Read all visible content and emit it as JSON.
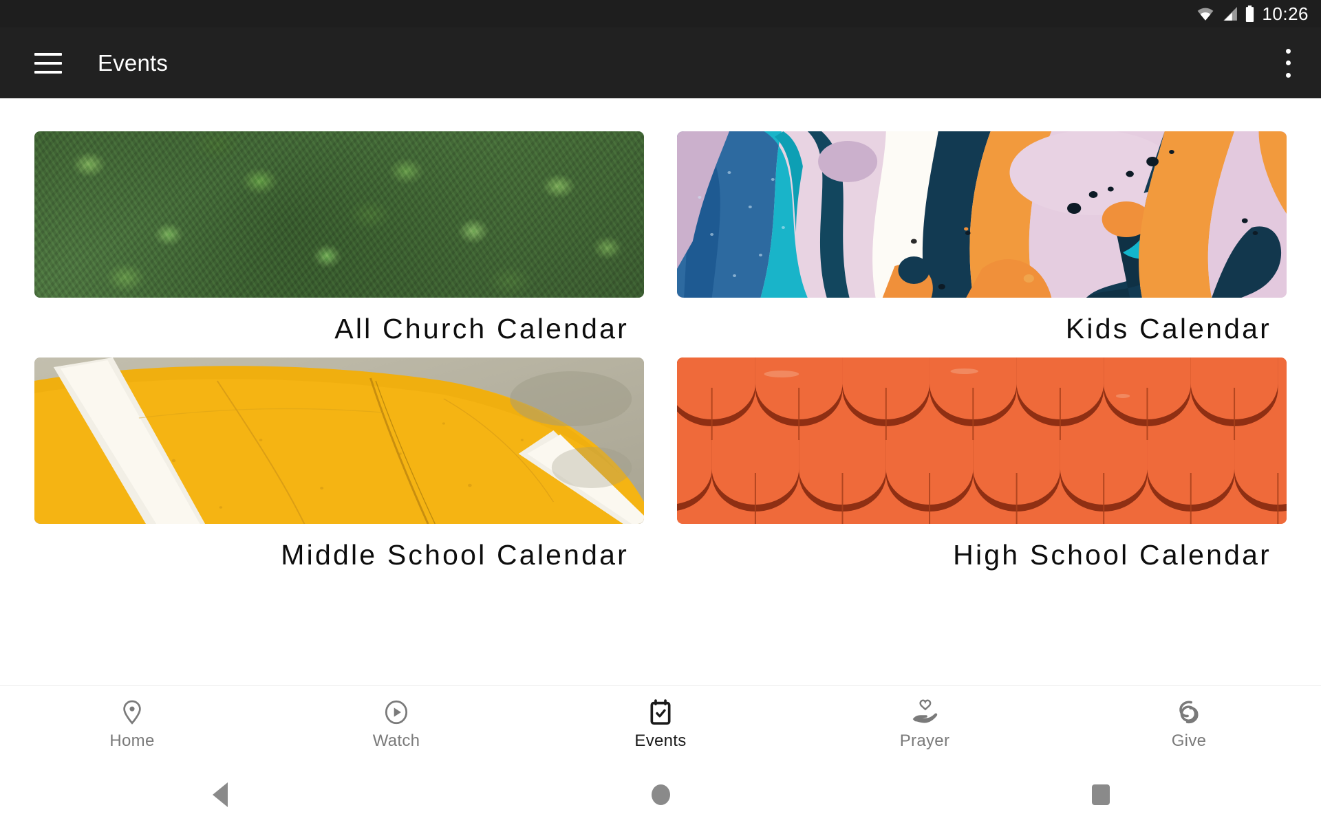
{
  "status_bar": {
    "time": "10:26",
    "icons": [
      "wifi-icon",
      "cellular-signal-icon",
      "battery-icon"
    ]
  },
  "app_bar": {
    "menu_icon": "hamburger-menu-icon",
    "title": "Events",
    "overflow_icon": "overflow-menu-icon",
    "background_color": "#212121",
    "text_color": "#ffffff"
  },
  "calendars": [
    {
      "title": "All Church Calendar",
      "image": "aerial-forest-tree-canopy",
      "dominant_color": "#4d7540"
    },
    {
      "title": "Kids Calendar",
      "image": "abstract-paint-pour-art",
      "dominant_color": "#e3c4d8"
    },
    {
      "title": "Middle School Calendar",
      "image": "yellow-painted-court-lines",
      "dominant_color": "#f5b413"
    },
    {
      "title": "High School Calendar",
      "image": "orange-scalloped-roof-tiles",
      "dominant_color": "#ef6a3a"
    }
  ],
  "bottom_nav": {
    "active": "Events",
    "items": [
      {
        "label": "Home",
        "icon": "map-pin-icon",
        "active": false
      },
      {
        "label": "Watch",
        "icon": "play-circle-icon",
        "active": false
      },
      {
        "label": "Events",
        "icon": "calendar-check-icon",
        "active": true
      },
      {
        "label": "Prayer",
        "icon": "hand-heart-icon",
        "active": false
      },
      {
        "label": "Give",
        "icon": "giving-swirl-icon",
        "active": false
      }
    ],
    "active_color": "#1a1a1a",
    "inactive_color": "#7a7a7a"
  },
  "system_nav": {
    "back": "back-triangle-icon",
    "home": "home-circle-icon",
    "recents": "recents-square-icon"
  }
}
